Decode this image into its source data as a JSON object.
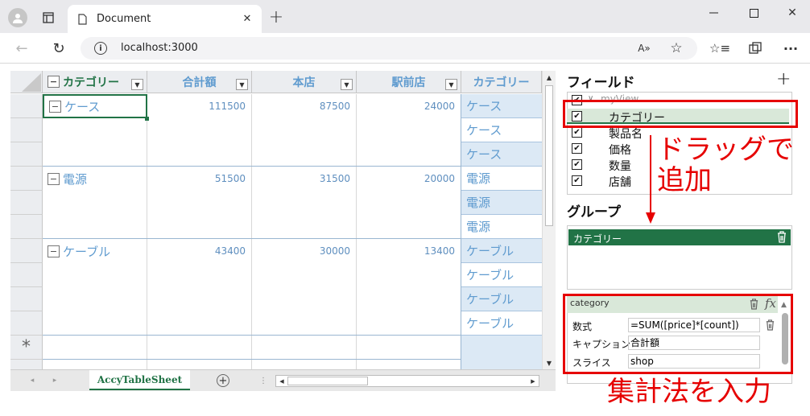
{
  "browser": {
    "tab_title": "Document",
    "url": "localhost:3000",
    "new_tab": "+"
  },
  "sheet": {
    "headers": [
      "カテゴリー",
      "合計額",
      "本店",
      "駅前店",
      "カテゴリー"
    ],
    "rows": [
      {
        "category": "ケース",
        "total": "111500",
        "main": "87500",
        "station": "24000",
        "pills": [
          "ケース",
          "ケース",
          "ケース"
        ]
      },
      {
        "category": "電源",
        "total": "51500",
        "main": "31500",
        "station": "20000",
        "pills": [
          "電源",
          "電源",
          "電源"
        ]
      },
      {
        "category": "ケーブル",
        "total": "43400",
        "main": "30000",
        "station": "13400",
        "pills": [
          "ケーブル",
          "ケーブル",
          "ケーブル",
          "ケーブル"
        ]
      }
    ],
    "new_row_marker": "*",
    "sheet_tab": "AccyTableSheet"
  },
  "fields": {
    "title": "フィールド",
    "add": "+",
    "root": "myView",
    "items": [
      "カテゴリー",
      "製品名",
      "価格",
      "数量",
      "店舗"
    ]
  },
  "group": {
    "title": "グループ",
    "item": "カテゴリー"
  },
  "calc": {
    "name": "category",
    "rows": [
      {
        "label": "数式",
        "value": "=SUM([price]*[count])"
      },
      {
        "label": "キャプション",
        "value": "合計額"
      },
      {
        "label": "スライス",
        "value": "shop"
      }
    ]
  },
  "annotations": {
    "drag": "ドラッグで",
    "drag2": "追加",
    "formula": "集計法を入力"
  },
  "colors": {
    "accent": "#217346",
    "annotation": "#e60000",
    "header_text": "#5f9bcf"
  }
}
